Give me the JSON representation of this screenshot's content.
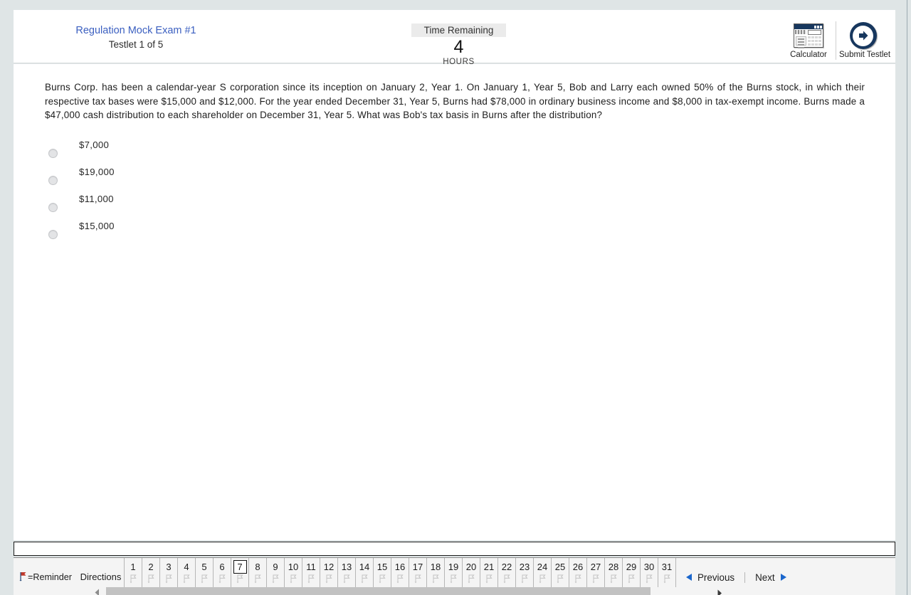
{
  "header": {
    "exam_title": "Regulation Mock Exam #1",
    "testlet_label": "Testlet 1 of 5",
    "timer": {
      "label": "Time Remaining",
      "value": "4",
      "units": "HOURS"
    },
    "tools": [
      {
        "label": "Calculator",
        "icon": "calculator-icon"
      },
      {
        "label": "Submit Testlet",
        "icon": "submit-arrow-icon"
      }
    ]
  },
  "question": {
    "text": "Burns Corp. has been a calendar-year S corporation since its inception on January 2, Year 1. On January 1, Year 5, Bob and Larry each owned 50% of the Burns stock, in which their respective tax bases were $15,000 and $12,000. For the year ended December 31, Year 5, Burns had $78,000 in ordinary business income and $8,000 in tax-exempt income. Burns made a $47,000 cash distribution to each shareholder on December 31, Year 5. What was Bob's tax basis in Burns after the distribution?",
    "options": [
      {
        "label": "$7,000",
        "selected": false
      },
      {
        "label": "$19,000",
        "selected": false
      },
      {
        "label": "$11,000",
        "selected": false
      },
      {
        "label": "$15,000",
        "selected": false
      }
    ]
  },
  "footer": {
    "reminder_key_label": "=Reminder",
    "directions_label": "Directions",
    "question_numbers": [
      "1",
      "2",
      "3",
      "4",
      "5",
      "6",
      "7",
      "8",
      "9",
      "10",
      "11",
      "12",
      "13",
      "14",
      "15",
      "16",
      "17",
      "18",
      "19",
      "20",
      "21",
      "22",
      "23",
      "24",
      "25",
      "26",
      "27",
      "28",
      "29",
      "30",
      "31"
    ],
    "current_question": "7",
    "previous_label": "Previous",
    "next_label": "Next"
  },
  "colors": {
    "link_blue": "#3b5fc0",
    "navy": "#17375e",
    "arrow_blue": "#1a66cc",
    "flag_red": "#c0392b",
    "page_bg": "#dfe5e6"
  }
}
